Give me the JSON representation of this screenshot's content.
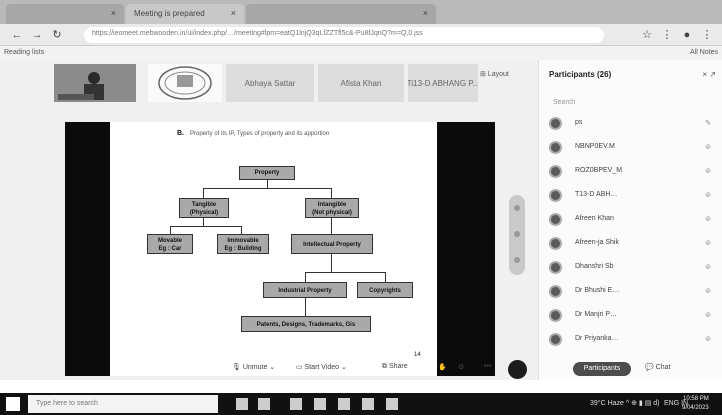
{
  "browser": {
    "tabs": [
      {
        "label": "",
        "close": "×"
      },
      {
        "label": "Meeting is prepared",
        "close": "×"
      },
      {
        "label": "",
        "close": "×"
      }
    ],
    "url": "https://ieomeet.mebwooden.in/ui/index.php/…/meeting#lpm=eatQ1lnjQ3qLfZZTfl5c&-Pu8fJqnQ?m=Q,0.jss",
    "bookmark_left": "Reading lists",
    "bookmark_right": "All Notes"
  },
  "meeting": {
    "tiles": [
      "Abhaya Sattar",
      "Afista Khan",
      "Ti13-D ABHANG P..."
    ],
    "layout_label": "Layout",
    "slide": {
      "heading_prefix": "B.",
      "heading": "Property of its IP, Types of property and its apportion",
      "nodes": {
        "property": "Property",
        "tangible": "Tangible\n(Physical)",
        "intangible": "Intangible\n(Not physical)",
        "movable": "Movable\nEg : Car",
        "immovable": "Immovable\nEg : Building",
        "intellectual": "Intellectual Property",
        "industrial": "Industrial Property",
        "copyrights": "Copyrights",
        "patents": "Patents, Designs, Trademarks, Gis"
      },
      "page_number": "14"
    },
    "controls": {
      "unmute": "Unmute",
      "share_screen": "Start Video",
      "share": "Share",
      "participants": "Participants",
      "chat": "Chat",
      "more": "•••"
    }
  },
  "participants": {
    "title": "Participants (26)",
    "close": "× ↗",
    "search_placeholder": "Search",
    "items": [
      {
        "name": "ps",
        "icon": "✎"
      },
      {
        "name": "NBNP0EV.M",
        "icon": "⊘"
      },
      {
        "name": "ROZ0BPEV_M",
        "icon": "⊘"
      },
      {
        "name": "T13-D ABH…",
        "icon": "⊘"
      },
      {
        "name": "Afreen Khan",
        "icon": "⊘"
      },
      {
        "name": "Afreen-ja Shik",
        "icon": "⊘"
      },
      {
        "name": "Dhanshri Sb",
        "icon": "⊘"
      },
      {
        "name": "Dr Bhushi E…",
        "icon": "⊘"
      },
      {
        "name": "Dr Manjri P…",
        "icon": "⊘"
      },
      {
        "name": "Dr Priyanka…",
        "icon": "⊘"
      }
    ]
  },
  "taskbar": {
    "search_placeholder": "Type here to search",
    "tray": "39°C Haze ^ ⊕ ▮ ▤ d)",
    "lang": "ENG IN",
    "time": "10:58 PM",
    "date": "9/04/2023"
  },
  "colors": {
    "taskbar": "#111111",
    "panel": "#fbfbfb",
    "end_button": "#1c1c1c"
  }
}
